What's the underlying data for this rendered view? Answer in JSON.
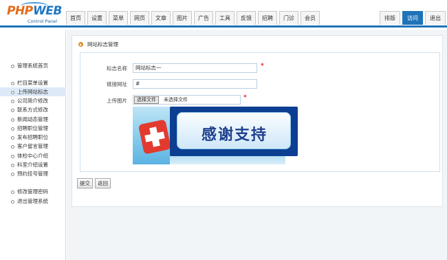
{
  "logo": {
    "text_php": "PHP",
    "text_web": "WEB",
    "subtitle": "Control Panel"
  },
  "nav": {
    "tabs": [
      "首页",
      "设置",
      "菜单",
      "网页",
      "文章",
      "图片",
      "广告",
      "工具",
      "反馈",
      "招聘",
      "门诊",
      "会员"
    ],
    "right_tabs": [
      "排版",
      "访问",
      "退出"
    ],
    "active_right": "访问"
  },
  "sidebar": {
    "items": [
      "管理系统首页",
      "栏目菜单设置",
      "上传网站标志",
      "公司简介修改",
      "联系方式修改",
      "新闻动态管理",
      "招聘职位管理",
      "发布招聘职位",
      "客户留言管理",
      "体检中心介绍",
      "科室介绍设置",
      "预约挂号管理",
      "修改管理密码",
      "退出管理系统"
    ],
    "active": "上传网站标志"
  },
  "panel": {
    "title": "网站标志管理",
    "form": {
      "name_label": "标志名称",
      "name_value": "网站标志一",
      "link_label": "链接网址",
      "link_value": "#",
      "image_label": "上传图片",
      "file_button": "选择文件",
      "file_text": "未选择文件",
      "required_mark": "*"
    },
    "preview_text": "感谢支持"
  },
  "buttons": {
    "submit": "提交",
    "back": "返回"
  },
  "colors": {
    "accent": "#1e73b9",
    "required": "#e02020",
    "logo_orange": "#e46b1a",
    "logo_blue": "#1f77c2"
  }
}
